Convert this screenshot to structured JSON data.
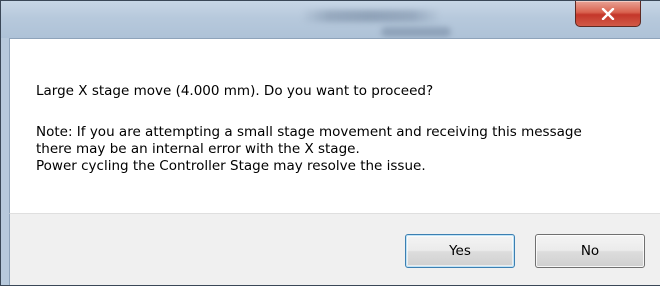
{
  "dialog": {
    "title": "",
    "message": "Large X stage move (4.000 mm). Do you want to proceed?",
    "note_lines": [
      "Note: If you are attempting a small stage movement and receiving this message",
      "there may be an internal error with the X stage.",
      "Power cycling the Controller Stage may resolve the issue."
    ]
  },
  "buttons": {
    "yes_label": "Yes",
    "no_label": "No",
    "close_icon": "close-x-icon"
  },
  "colors": {
    "frame": "#b7c9dc",
    "close_button": "#c4372a",
    "content_bg": "#ffffff",
    "footer_bg": "#f0f0f0",
    "default_button_border": "#3c7fb1"
  }
}
